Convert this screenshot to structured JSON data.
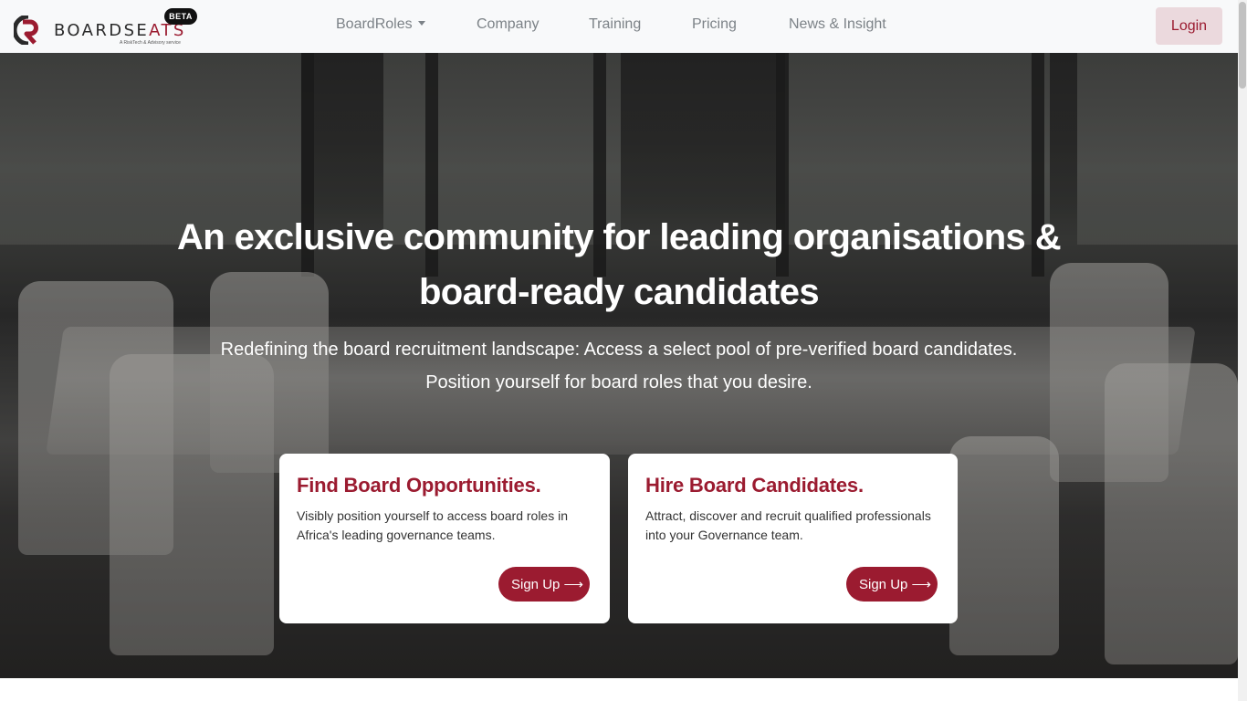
{
  "brand": {
    "name_main": "BOARDSE",
    "name_accent": "ATS",
    "tagline": "A RiskTech & Advisory service",
    "badge": "BETA",
    "accent_color": "#9b1b30"
  },
  "nav": {
    "items": [
      {
        "label": "BoardRoles",
        "has_dropdown": true
      },
      {
        "label": "Company"
      },
      {
        "label": "Training"
      },
      {
        "label": "Pricing"
      },
      {
        "label": "News & Insight"
      }
    ],
    "login_label": "Login"
  },
  "hero": {
    "title": "An exclusive community for leading organisations & board-ready candidates",
    "subtitle": "Redefining the board recruitment landscape: Access a select pool of pre-verified board candidates. Position yourself for board roles that you desire."
  },
  "cards": [
    {
      "title": "Find Board Opportunities.",
      "text": "Visibly position yourself to access board roles in Africa's leading governance teams.",
      "button_label": "Sign Up ⟶"
    },
    {
      "title": "Hire Board Candidates.",
      "text": "Attract, discover and recruit qualified professionals into your Governance team.",
      "button_label": "Sign Up ⟶"
    }
  ],
  "icons": {
    "logo": "boardseats-logo-icon",
    "dropdown": "caret-down-icon"
  }
}
